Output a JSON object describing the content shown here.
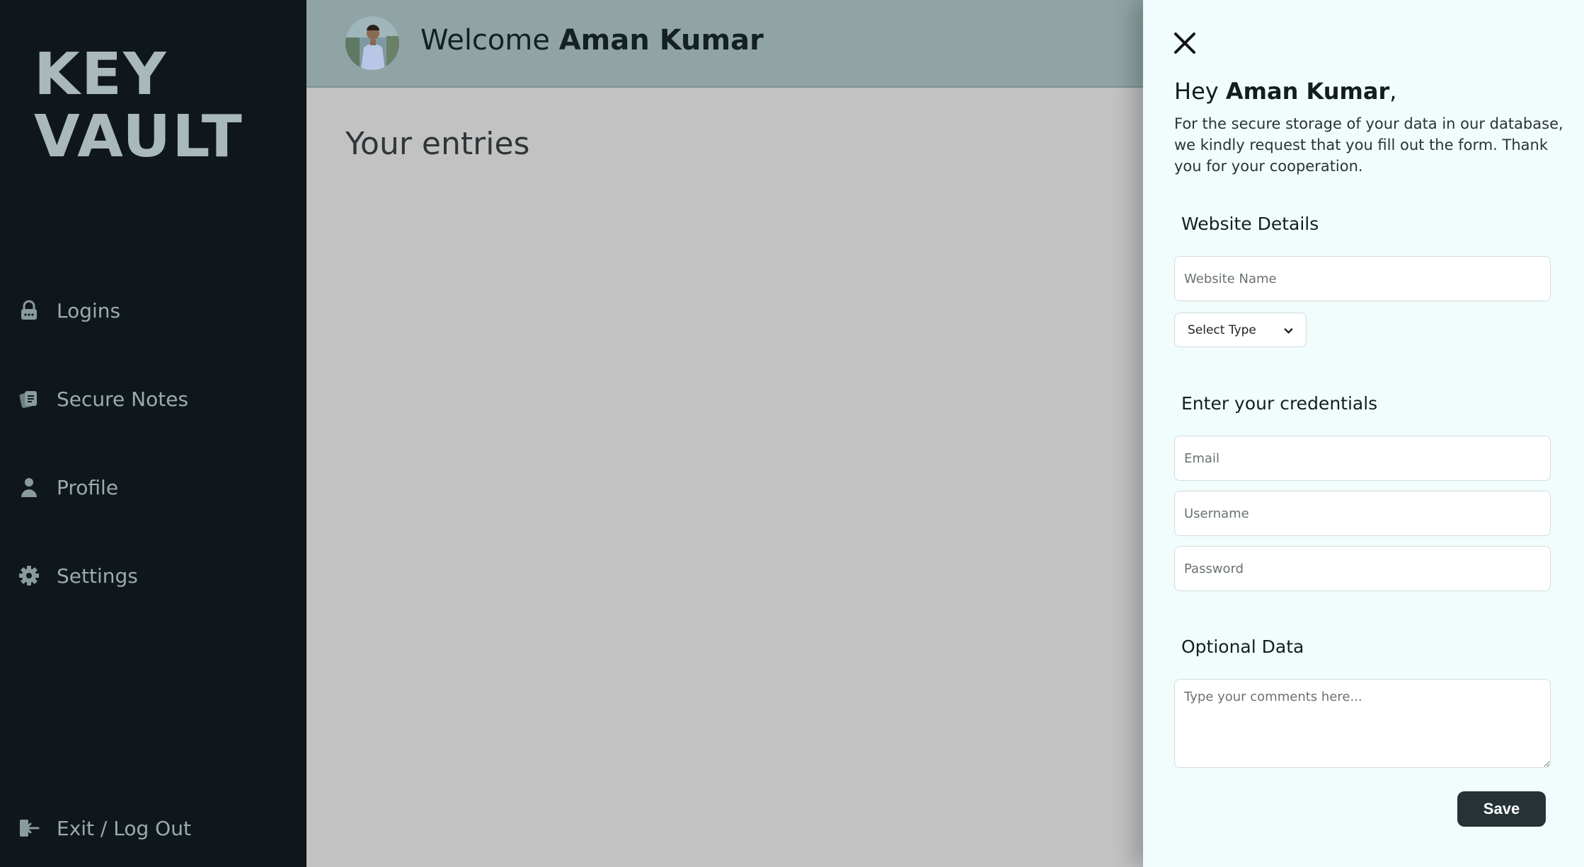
{
  "sidebar": {
    "logo_line1": "KEY",
    "logo_line2": "VAULT",
    "items": [
      {
        "label": "Logins",
        "icon": "lock-icon"
      },
      {
        "label": "Secure Notes",
        "icon": "note-icon"
      },
      {
        "label": "Profile",
        "icon": "user-icon"
      },
      {
        "label": "Settings",
        "icon": "gear-icon"
      }
    ],
    "logout": {
      "label": "Exit / Log Out",
      "icon": "logout-icon"
    }
  },
  "header": {
    "welcome_prefix": "Welcome",
    "user_name": "Aman Kumar"
  },
  "main": {
    "title": "Your entries"
  },
  "panel": {
    "greeting_prefix": "Hey",
    "greeting_name": "Aman Kumar",
    "greeting_suffix": ",",
    "intro": "For the secure storage of your data in our database, we kindly request that you fill out the form. Thank you for your cooperation.",
    "website_section": "Website Details",
    "website_name_placeholder": "Website Name",
    "select_type": "Select Type",
    "credentials_section": "Enter your credentials",
    "email_placeholder": "Email",
    "username_placeholder": "Username",
    "password_placeholder": "Password",
    "optional_section": "Optional Data",
    "comments_placeholder": "Type your comments here...",
    "save_label": "Save"
  },
  "colors": {
    "sidebar_bg": "#10171b",
    "sidebar_text": "#9aabad",
    "header_bg": "#90a4a6",
    "main_bg": "#c2c2c2",
    "panel_bg": "#f1fdfd",
    "button_bg": "#263236"
  }
}
